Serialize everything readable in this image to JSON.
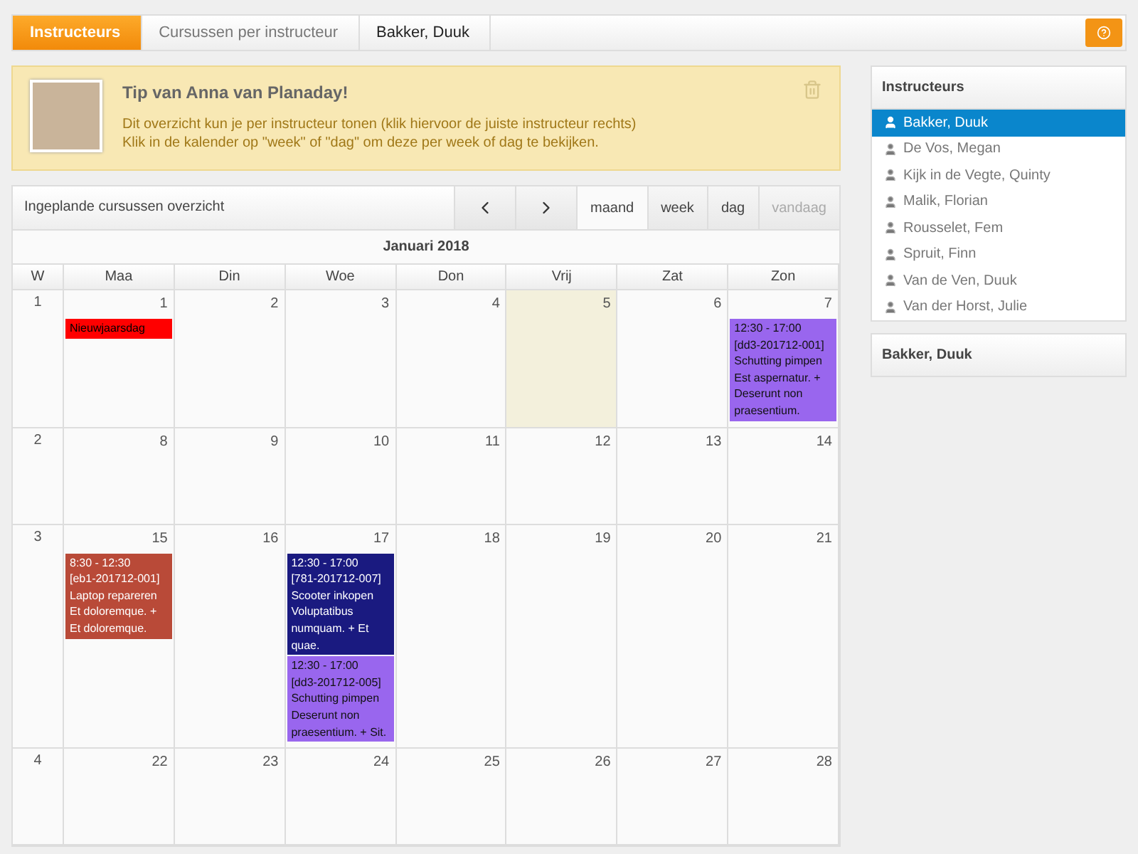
{
  "breadcrumb": [
    {
      "label": "Instructeurs",
      "selected": true
    },
    {
      "label": "Cursussen per instructeur",
      "selected": false
    },
    {
      "label": "Bakker, Duuk",
      "selected": false
    }
  ],
  "tip": {
    "title": "Tip van Anna van Planaday!",
    "lines": [
      "Dit overzicht kun je per instructeur tonen (klik hiervoor de juiste instructeur rechts)",
      "Klik in de kalender op \"week\" of \"dag\" om deze per week of dag te bekijken."
    ]
  },
  "calendar": {
    "title": "Ingeplande cursussen overzicht",
    "views": [
      {
        "label": "maand",
        "selected": true,
        "disabled": false
      },
      {
        "label": "week",
        "selected": false,
        "disabled": false
      },
      {
        "label": "dag",
        "selected": false,
        "disabled": false
      },
      {
        "label": "vandaag",
        "selected": false,
        "disabled": true
      }
    ],
    "month": "Januari 2018",
    "week_header": "W",
    "day_headers": [
      "Maa",
      "Din",
      "Woe",
      "Don",
      "Vrij",
      "Zat",
      "Zon"
    ],
    "weeks": [
      {
        "number": "1",
        "days": [
          {
            "date": "1",
            "today": false,
            "events": [
              {
                "kind": "holiday",
                "color": "#ff0000",
                "lines": [
                  "Nieuwjaarsdag"
                ]
              }
            ]
          },
          {
            "date": "2",
            "today": false
          },
          {
            "date": "3",
            "today": false
          },
          {
            "date": "4",
            "today": false
          },
          {
            "date": "5",
            "today": true
          },
          {
            "date": "6",
            "today": false
          },
          {
            "date": "7",
            "today": false,
            "events": [
              {
                "kind": "course",
                "color": "#9966ee",
                "lines": [
                  "12:30 - 17:00",
                  "[dd3-201712-001]",
                  "Schutting pimpen",
                  "Est aspernatur. + Deserunt non praesentium."
                ]
              }
            ]
          }
        ]
      },
      {
        "number": "2",
        "days": [
          {
            "date": "8",
            "today": false
          },
          {
            "date": "9",
            "today": false
          },
          {
            "date": "10",
            "today": false
          },
          {
            "date": "11",
            "today": false
          },
          {
            "date": "12",
            "today": false
          },
          {
            "date": "13",
            "today": false
          },
          {
            "date": "14",
            "today": false
          }
        ]
      },
      {
        "number": "3",
        "days": [
          {
            "date": "15",
            "today": false,
            "events": [
              {
                "kind": "course",
                "color": "#b94a38",
                "lines": [
                  "8:30 - 12:30",
                  "[eb1-201712-001]",
                  "Laptop repareren",
                  "Et doloremque. + Et doloremque."
                ]
              }
            ]
          },
          {
            "date": "16",
            "today": false
          },
          {
            "date": "17",
            "today": false,
            "events": [
              {
                "kind": "course",
                "color": "#1a1a80",
                "lines": [
                  "12:30 - 17:00",
                  "[781-201712-007]",
                  "Scooter inkopen",
                  "Voluptatibus numquam. + Et quae."
                ]
              },
              {
                "kind": "course",
                "color": "#9966ee",
                "lines": [
                  "12:30 - 17:00",
                  "[dd3-201712-005]",
                  "Schutting pimpen",
                  "Deserunt non praesentium. + Sit."
                ]
              }
            ]
          },
          {
            "date": "18",
            "today": false
          },
          {
            "date": "19",
            "today": false
          },
          {
            "date": "20",
            "today": false
          },
          {
            "date": "21",
            "today": false
          }
        ]
      },
      {
        "number": "4",
        "days": [
          {
            "date": "22",
            "today": false
          },
          {
            "date": "23",
            "today": false
          },
          {
            "date": "24",
            "today": false
          },
          {
            "date": "25",
            "today": false
          },
          {
            "date": "26",
            "today": false
          },
          {
            "date": "27",
            "today": false
          },
          {
            "date": "28",
            "today": false
          }
        ]
      }
    ]
  },
  "sidebar": {
    "title": "Instructeurs",
    "items": [
      {
        "label": "Bakker, Duuk",
        "selected": true
      },
      {
        "label": "De Vos, Megan",
        "selected": false
      },
      {
        "label": "Kijk in de Vegte, Quinty",
        "selected": false
      },
      {
        "label": "Malik, Florian",
        "selected": false
      },
      {
        "label": "Rousselet, Fem",
        "selected": false
      },
      {
        "label": "Spruit, Finn",
        "selected": false
      },
      {
        "label": "Van de Ven, Duuk",
        "selected": false
      },
      {
        "label": "Van der Horst, Julie",
        "selected": false
      }
    ]
  },
  "selected_panel": {
    "title": "Bakker, Duuk"
  }
}
